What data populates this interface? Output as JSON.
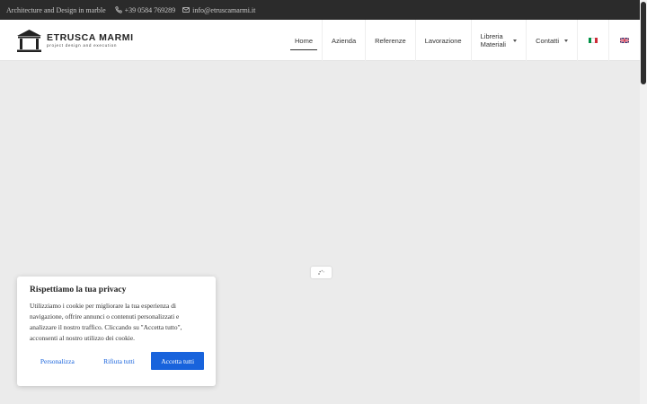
{
  "topbar": {
    "tagline": "Architecture and Design in marble",
    "phone": "+39 0584 769289",
    "email": "info@etruscamarmi.it",
    "icons": [
      "phone-icon",
      "mail-icon"
    ]
  },
  "logo": {
    "title": "ETRUSCA MARMI",
    "subtitle": "project design and execution"
  },
  "nav": {
    "items": [
      {
        "label": "Home",
        "active": true
      },
      {
        "label": "Azienda"
      },
      {
        "label": "Referenze"
      },
      {
        "label": "Lavorazione"
      },
      {
        "label": "Libreria Materiali",
        "dropdown": true
      },
      {
        "label": "Contatti",
        "dropdown": true
      }
    ],
    "languages": [
      "flag-it-icon",
      "flag-uk-icon"
    ]
  },
  "cookie": {
    "title": "Rispettiamo la tua privacy",
    "text": "Utilizziamo i cookie per migliorare la tua esperienza di navigazione, offrire annunci o contenuti personalizzati e analizzare il nostro traffico. Cliccando su \"Accetta tutto\", acconsenti al nostro utilizzo dei cookie.",
    "customize_label": "Personalizza",
    "reject_label": "Rifiuta tutti",
    "accept_label": "Accetta tutti"
  },
  "colors": {
    "topbar_bg": "#2b2b2b",
    "accent": "#1863dc",
    "page_bg": "#ebebeb"
  }
}
